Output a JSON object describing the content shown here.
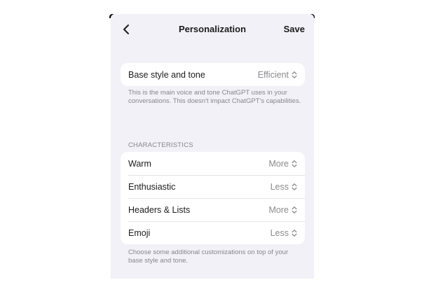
{
  "nav": {
    "title": "Personalization",
    "save_label": "Save",
    "back_icon": "chevron-left-icon"
  },
  "base_style": {
    "label": "Base style and tone",
    "value": "Efficient",
    "footnote": "This is the main voice and tone ChatGPT uses in your conversations. This doesn't impact ChatGPT's capabilities."
  },
  "characteristics": {
    "header": "CHARACTERISTICS",
    "items": [
      {
        "label": "Warm",
        "value": "More"
      },
      {
        "label": "Enthusiastic",
        "value": "Less"
      },
      {
        "label": "Headers & Lists",
        "value": "More"
      },
      {
        "label": "Emoji",
        "value": "Less"
      }
    ],
    "footnote": "Choose some additional customizations on top of your base style and tone."
  },
  "colors": {
    "background": "#f1f1f7",
    "card": "#ffffff",
    "text": "#1c1c1e",
    "secondary_text": "#8a8a8e"
  }
}
